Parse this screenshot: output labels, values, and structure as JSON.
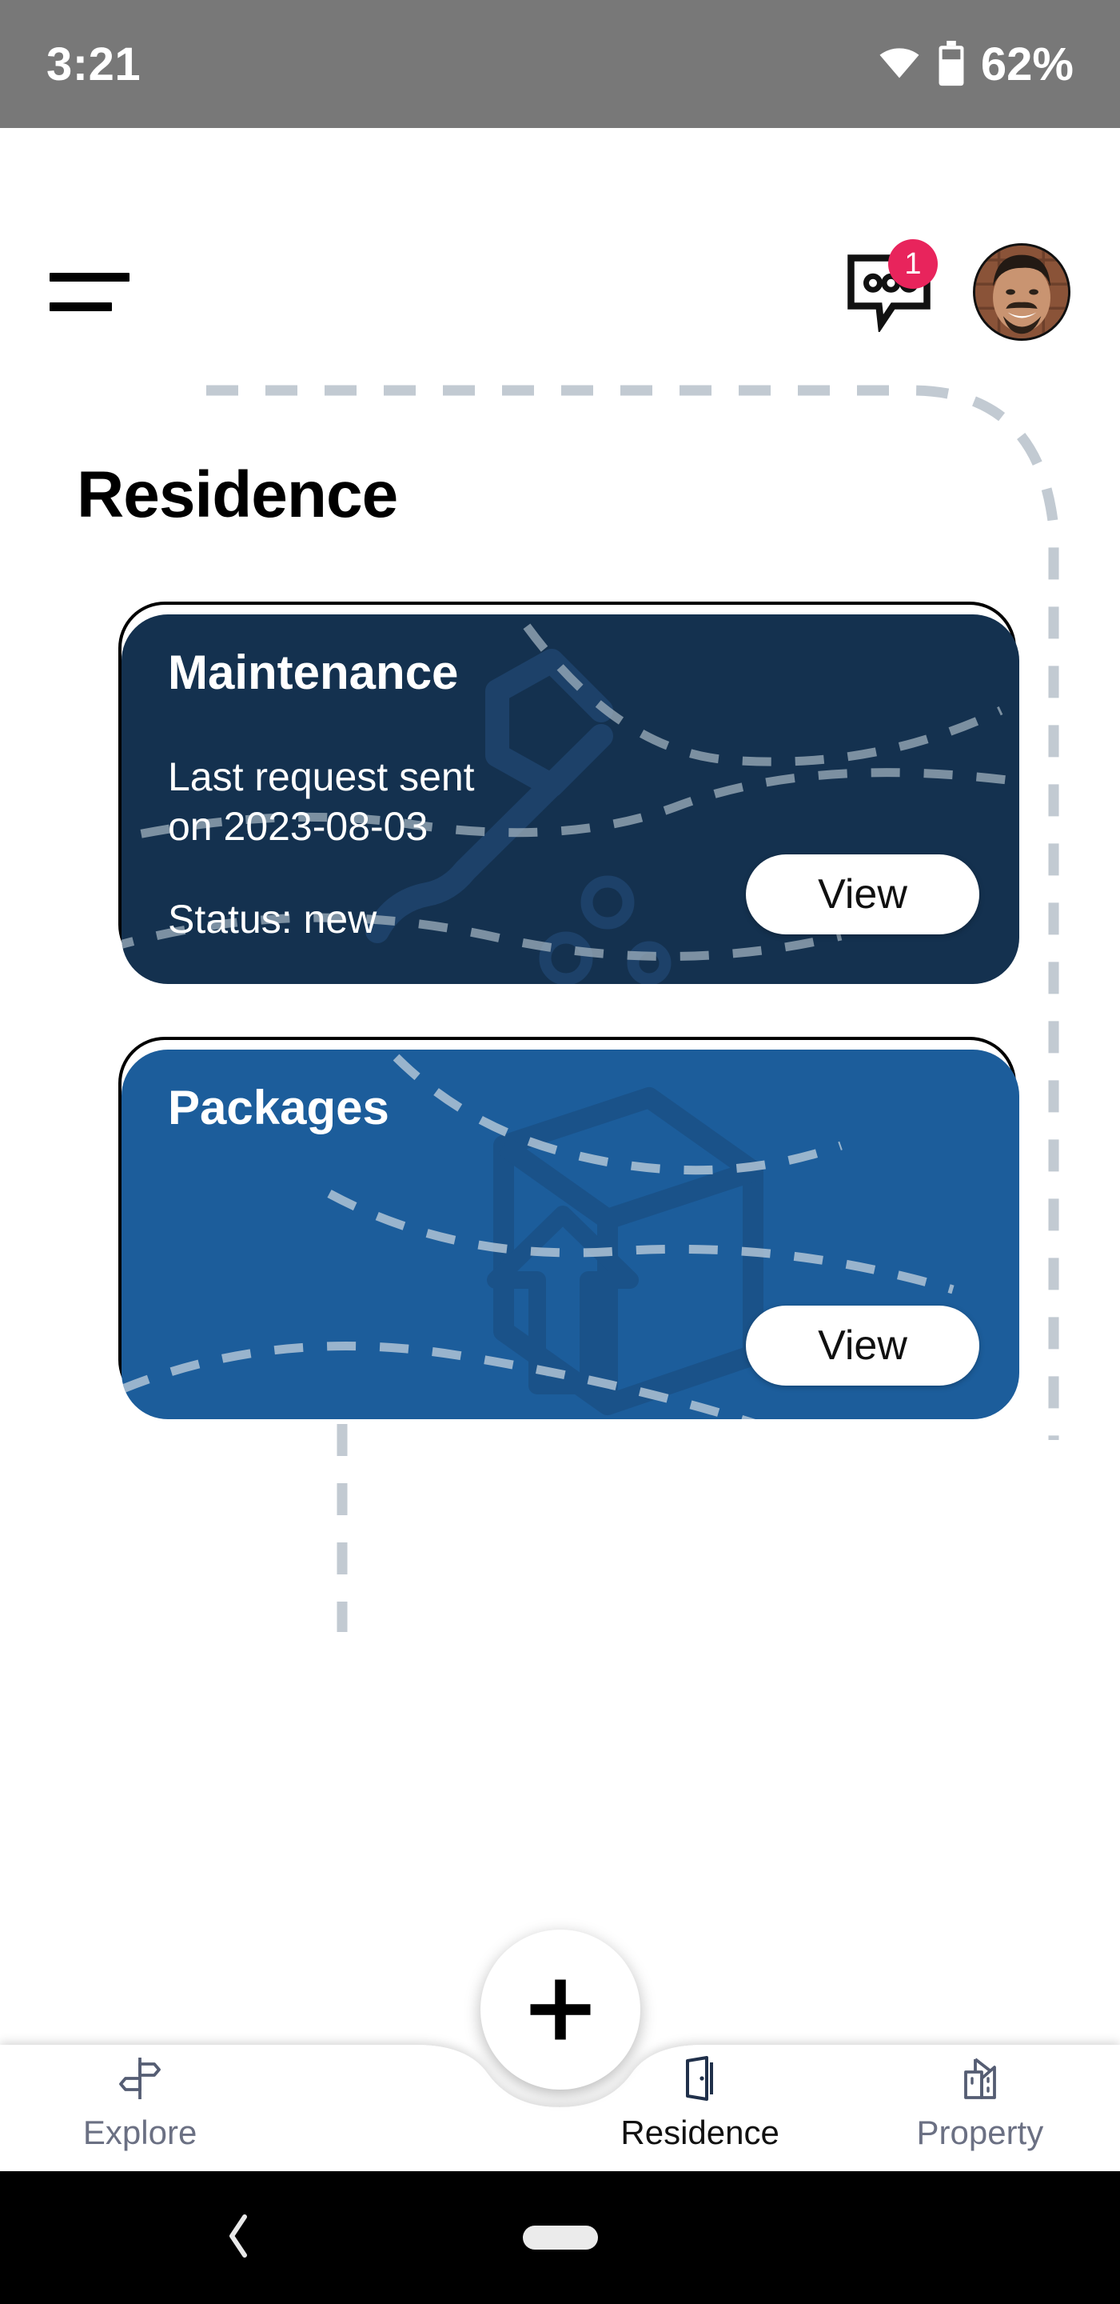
{
  "status_bar": {
    "time": "3:21",
    "battery_percent": "62%",
    "wifi_icon": "wifi-icon",
    "battery_icon": "battery-icon",
    "background_color": "#787878"
  },
  "app_bar": {
    "menu_icon": "hamburger-menu-icon",
    "chat_icon": "chat-bubble-icon",
    "chat_badge_count": "1",
    "chat_badge_color": "#e8245c",
    "avatar_icon": "user-avatar"
  },
  "page": {
    "title": "Residence"
  },
  "cards": [
    {
      "title": "Maintenance",
      "subtitle": "Last request sent\non 2023-08-03",
      "status": "Status:  new",
      "button_label": "View",
      "background_color": "#14314f",
      "art_icon": "wrench-icon"
    },
    {
      "title": "Packages",
      "subtitle": "",
      "status": "",
      "button_label": "View",
      "background_color": "#1c5d9b",
      "art_icon": "package-box-icon"
    }
  ],
  "bottom_nav": {
    "fab_icon": "plus-icon",
    "items": [
      {
        "label": "Explore",
        "icon": "signpost-icon",
        "active": false
      },
      {
        "label": "Residence",
        "icon": "open-door-icon",
        "active": true
      },
      {
        "label": "Property",
        "icon": "buildings-icon",
        "active": false
      }
    ],
    "active_color": "#111111",
    "inactive_color": "#6b7083"
  },
  "android_nav": {
    "back_icon": "back-chevron-icon",
    "home_icon": "home-pill-icon"
  }
}
